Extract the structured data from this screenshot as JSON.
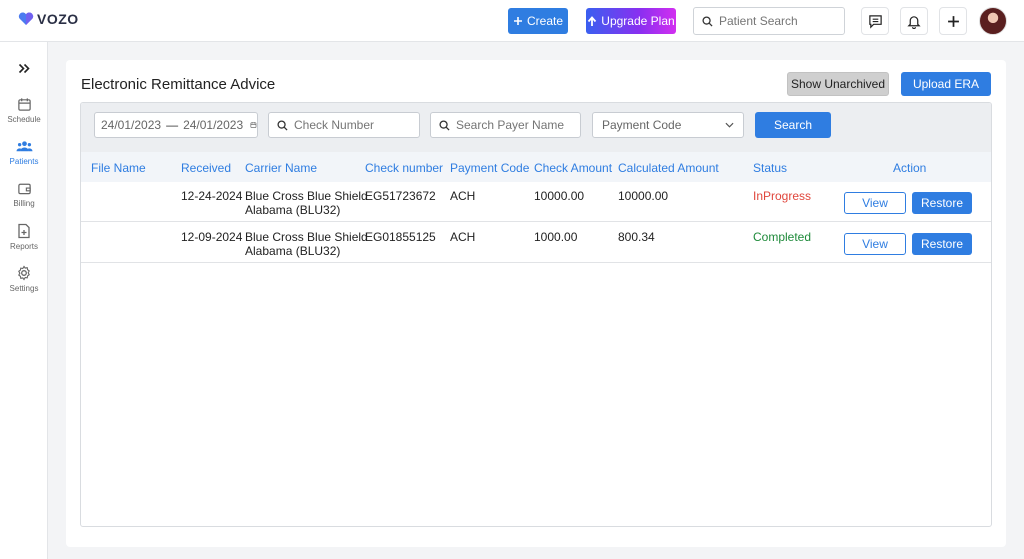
{
  "header": {
    "logo_text": "VOZO",
    "create_label": "Create",
    "upgrade_label": "Upgrade Plan",
    "search_placeholder": "Patient Search",
    "icons": [
      "message-icon",
      "bell-icon",
      "plus-icon"
    ]
  },
  "sidebar": {
    "items": [
      {
        "label": "Schedule",
        "icon": "calendar-icon",
        "active": false
      },
      {
        "label": "Patients",
        "icon": "users-icon",
        "active": true
      },
      {
        "label": "Billing",
        "icon": "wallet-icon",
        "active": false
      },
      {
        "label": "Reports",
        "icon": "report-icon",
        "active": false
      },
      {
        "label": "Settings",
        "icon": "gear-icon",
        "active": false
      }
    ]
  },
  "page": {
    "title": "Electronic Remittance Advice",
    "show_unarchived_label": "Show Unarchived",
    "upload_label": "Upload ERA"
  },
  "filters": {
    "date_from": "24/01/2023",
    "date_to": "24/01/2023",
    "check_number_placeholder": "Check Number",
    "payer_placeholder": "Search Payer Name",
    "payment_code_placeholder": "Payment Code",
    "search_label": "Search"
  },
  "table": {
    "columns": [
      "File Name",
      "Received",
      "Carrier Name",
      "Check number",
      "Payment Code",
      "Check Amount",
      "Calculated Amount",
      "Status",
      "Action"
    ],
    "rows": [
      {
        "file_name": "",
        "received": "12-24-2024",
        "carrier_line1": "Blue Cross Blue Shield",
        "carrier_line2": "Alabama (BLU32)",
        "check_number": "EG51723672",
        "payment_code": "ACH",
        "check_amount": "10000.00",
        "calculated_amount": "10000.00",
        "status": "InProgress",
        "view_label": "View",
        "restore_label": "Restore"
      },
      {
        "file_name": "",
        "received": "12-09-2024",
        "carrier_line1": "Blue Cross Blue Shield",
        "carrier_line2": "Alabama (BLU32)",
        "check_number": "EG01855125",
        "payment_code": "ACH",
        "check_amount": "1000.00",
        "calculated_amount": "800.34",
        "status": "Completed",
        "view_label": "View",
        "restore_label": "Restore"
      }
    ]
  },
  "colors": {
    "accent": "#2f7de1",
    "status_in_progress": "#e0463c",
    "status_completed": "#1e8a3a"
  }
}
